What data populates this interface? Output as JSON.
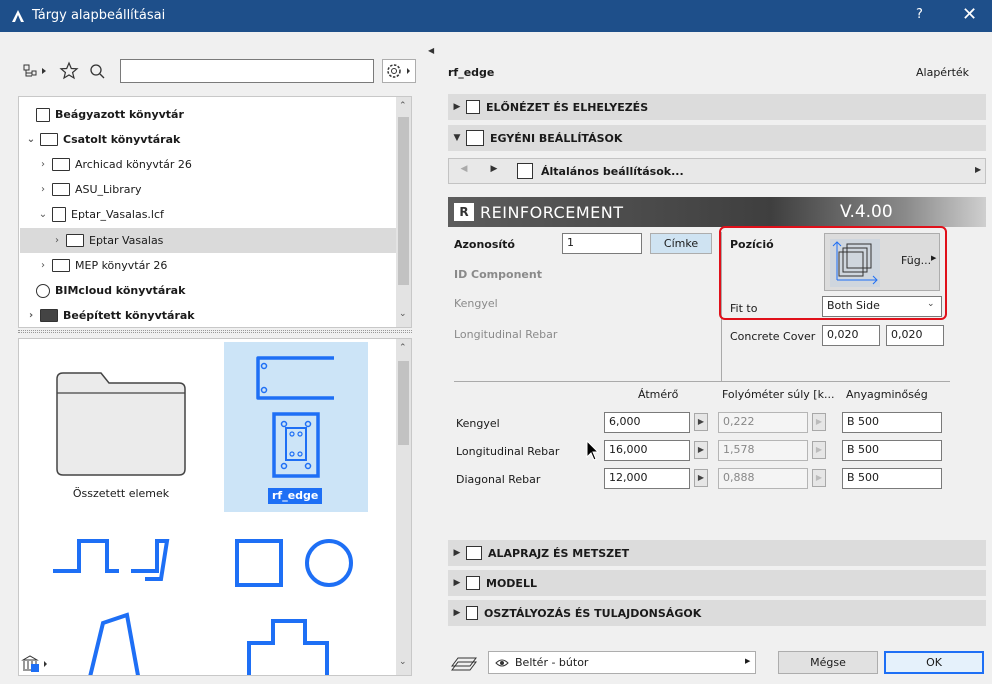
{
  "window": {
    "title": "Tárgy alapbeállításai",
    "help": "?",
    "close": "✕"
  },
  "left": {
    "search_value": "",
    "tree": [
      {
        "label": "Beágyazott könyvtár",
        "bold": true
      },
      {
        "label": "Csatolt könyvtárak",
        "bold": true
      },
      {
        "label": "Archicad könyvtár 26",
        "bold": false
      },
      {
        "label": "ASU_Library",
        "bold": false
      },
      {
        "label": "Eptar_Vasalas.lcf",
        "bold": false
      },
      {
        "label": "Eptar Vasalas",
        "bold": false
      },
      {
        "label": "MEP könyvtár 26",
        "bold": false
      },
      {
        "label": "BIMcloud könyvtárak",
        "bold": true
      },
      {
        "label": "Beépített könyvtárak",
        "bold": true
      }
    ],
    "grid": [
      {
        "label": "Összetett elemek"
      },
      {
        "label": "rf_edge"
      }
    ]
  },
  "right": {
    "object_name": "rf_edge",
    "default_label": "Alapérték",
    "sections": {
      "preview": "ELŐNÉZET ÉS ELHELYEZÉS",
      "custom": "EGYÉNI BEÁLLÍTÁSOK",
      "floorplan": "ALAPRAJZ ÉS METSZET",
      "model": "MODELL",
      "classification": "OSZTÁLYOZÁS ÉS TULAJDONSÁGOK"
    },
    "page_nav": {
      "label": "Általános beállítások..."
    },
    "banner": {
      "title": "REINFORCEMENT",
      "version": "V.4.00"
    },
    "params": {
      "id_label": "Azonosító",
      "id_value": "1",
      "label_button": "Címke",
      "id_component": "ID Component",
      "kengyel": "Kengyel",
      "long_rebar": "Longitudinal Rebar",
      "position_label": "Pozíció",
      "position_btn": "Füg...",
      "fit_label": "Fit to",
      "fit_value": "Both Side",
      "cover_label": "Concrete Cover",
      "cover_1": "0,020",
      "cover_2": "0,020"
    },
    "table": {
      "headers": [
        "Átmérő",
        "Folyóméter súly [k...",
        "Anyagminőség"
      ],
      "rows": [
        {
          "name": "Kengyel",
          "diameter": "6,000",
          "weight": "0,222",
          "material": "B 500"
        },
        {
          "name": "Longitudinal Rebar",
          "diameter": "16,000",
          "weight": "1,578",
          "material": "B 500"
        },
        {
          "name": "Diagonal Rebar",
          "diameter": "12,000",
          "weight": "0,888",
          "material": "B 500"
        }
      ]
    },
    "footer": {
      "layer_value": "Beltér - bútor",
      "cancel": "Mégse",
      "ok": "OK"
    }
  },
  "colors": {
    "titlebar": "#1e4f8a",
    "selection": "#cce4f7",
    "accent_blue": "#1e6ff5",
    "highlight_red": "#e0101a"
  }
}
